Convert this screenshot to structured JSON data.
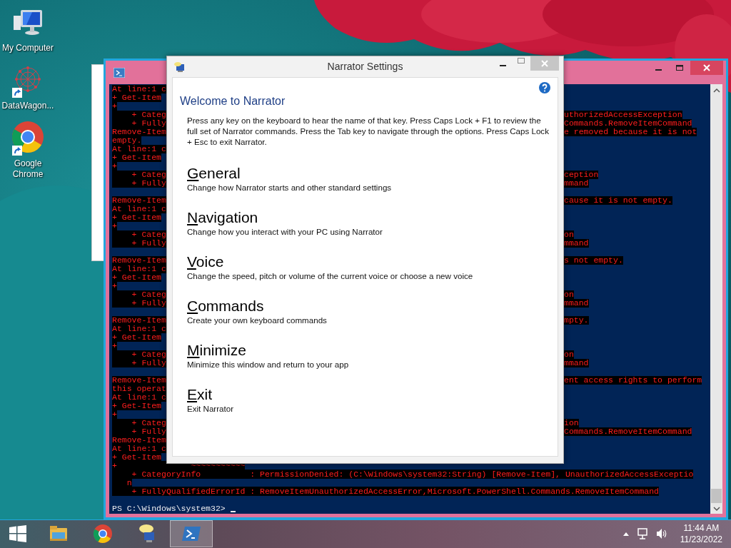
{
  "desktop_icons": [
    {
      "label": "My Computer",
      "kind": "computer",
      "shortcut": false
    },
    {
      "label": "DataWagon...",
      "kind": "network",
      "shortcut": true
    },
    {
      "label": "Google Chrome",
      "kind": "chrome",
      "shortcut": true
    }
  ],
  "powershell_window": {
    "console_lines": [
      {
        "kind": "split",
        "left": "At line:1 c"
      },
      {
        "kind": "split",
        "left": "+ Get-Item"
      },
      {
        "kind": "split",
        "left": "+"
      },
      {
        "kind": "split",
        "left": "    + Categ",
        "right": "uthorizedAccessException"
      },
      {
        "kind": "split",
        "left": "    + Fully",
        "right": "Commands.RemoveItemCommand"
      },
      {
        "kind": "split",
        "left": "Remove-Item",
        "right": "e removed because it is not"
      },
      {
        "kind": "split",
        "left": "empty."
      },
      {
        "kind": "split",
        "left": "At line:1 c"
      },
      {
        "kind": "split",
        "left": "+ Get-Item"
      },
      {
        "kind": "split",
        "left": "+"
      },
      {
        "kind": "split",
        "left": "    + Categ",
        "right": "ception"
      },
      {
        "kind": "split",
        "left": "    + Fully",
        "right": "mmand"
      },
      {
        "kind": "blank"
      },
      {
        "kind": "split",
        "left": "Remove-Item",
        "right": "cause it is not empty."
      },
      {
        "kind": "split",
        "left": "At line:1 c"
      },
      {
        "kind": "split",
        "left": "+ Get-Item"
      },
      {
        "kind": "split",
        "left": "+"
      },
      {
        "kind": "split",
        "left": "    + Categ",
        "right": "on"
      },
      {
        "kind": "split",
        "left": "    + Fully",
        "right": "mmand"
      },
      {
        "kind": "blank"
      },
      {
        "kind": "split",
        "left": "Remove-Item",
        "right": "s not empty."
      },
      {
        "kind": "split",
        "left": "At line:1 c"
      },
      {
        "kind": "split",
        "left": "+ Get-Item"
      },
      {
        "kind": "split",
        "left": "+"
      },
      {
        "kind": "split",
        "left": "    + Categ",
        "right": "on"
      },
      {
        "kind": "split",
        "left": "    + Fully",
        "right": "mmand"
      },
      {
        "kind": "blank"
      },
      {
        "kind": "split",
        "left": "Remove-Item",
        "right": "mpty."
      },
      {
        "kind": "split",
        "left": "At line:1 c"
      },
      {
        "kind": "split",
        "left": "+ Get-Item"
      },
      {
        "kind": "split",
        "left": "+"
      },
      {
        "kind": "split",
        "left": "    + Categ",
        "right": "on"
      },
      {
        "kind": "split",
        "left": "    + Fully",
        "right": "mmand"
      },
      {
        "kind": "blank"
      },
      {
        "kind": "split",
        "left": "Remove-Item",
        "right": "ent access rights to perform"
      },
      {
        "kind": "split",
        "left": "this operat"
      },
      {
        "kind": "split",
        "left": "At line:1 c"
      },
      {
        "kind": "split",
        "left": "+ Get-Item"
      },
      {
        "kind": "split",
        "left": "+"
      },
      {
        "kind": "split",
        "left": "    + Categ",
        "right": "ion"
      },
      {
        "kind": "split",
        "left": "    + Fully",
        "right": "Commands.RemoveItemCommand"
      },
      {
        "kind": "split",
        "left": "Remove-Item"
      },
      {
        "kind": "split",
        "left": "At line:1 c"
      },
      {
        "kind": "split",
        "left": "+ Get-Item"
      },
      {
        "kind": "full",
        "text": "+               ~~~~~~~~~~~"
      },
      {
        "kind": "full",
        "text": "    + CategoryInfo          : PermissionDenied: (C:\\Windows\\system32:String) [Remove-Item], UnauthorizedAccessExceptio"
      },
      {
        "kind": "full",
        "text": "   n"
      },
      {
        "kind": "full",
        "text": "    + FullyQualifiedErrorId : RemoveItemUnauthorizedAccessError,Microsoft.PowerShell.Commands.RemoveItemCommand"
      },
      {
        "kind": "blank"
      },
      {
        "kind": "prompt",
        "text": "PS C:\\Windows\\system32>"
      }
    ]
  },
  "narrator_window": {
    "title": "Narrator Settings",
    "heading": "Welcome to Narrator",
    "intro": "Press any key on the keyboard to hear the name of that key. Press Caps Lock + F1 to review the full set of Narrator commands. Press the Tab key to navigate through the options. Press Caps Lock + Esc to exit Narrator.",
    "options": [
      {
        "access_key": "G",
        "rest": "eneral",
        "description": "Change how Narrator starts and other standard settings"
      },
      {
        "access_key": "N",
        "rest": "avigation",
        "description": "Change how you interact with your PC using Narrator"
      },
      {
        "access_key": "V",
        "rest": "oice",
        "description": "Change the speed, pitch or volume of the current voice or choose a new voice"
      },
      {
        "access_key": "C",
        "rest": "ommands",
        "description": "Create your own keyboard commands"
      },
      {
        "access_key": "M",
        "rest": "inimize",
        "description": "Minimize this window and return to your app"
      },
      {
        "access_key": "E",
        "rest": "xit",
        "description": "Exit Narrator"
      }
    ]
  },
  "taskbar": {
    "apps": [
      {
        "kind": "explorer",
        "selected": false
      },
      {
        "kind": "chrome",
        "selected": false
      },
      {
        "kind": "narrator",
        "selected": false
      },
      {
        "kind": "powershell",
        "selected": true
      }
    ],
    "time": "11:44 AM",
    "date": "11/23/2022"
  }
}
